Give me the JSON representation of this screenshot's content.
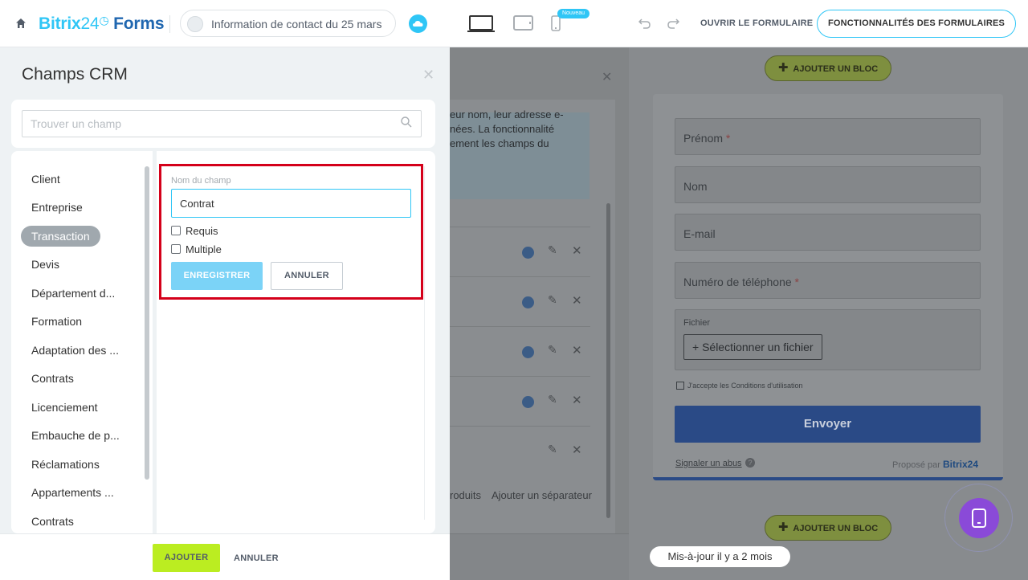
{
  "topbar": {
    "brand_name": "Bitrix",
    "brand_24": "24",
    "brand_suffix": "Forms",
    "form_name": "Information de contact du 25 mars",
    "new_badge": "Nouveau",
    "open_form": "OUVRIR LE FORMULAIRE",
    "features": "FONCTIONNALITÉS DES FORMULAIRES"
  },
  "crm": {
    "title": "Champs CRM",
    "search_placeholder": "Trouver un champ",
    "categories": [
      "Client",
      "Entreprise",
      "Transaction",
      "Devis",
      "Département d...",
      "Formation",
      "Adaptation des ...",
      "Contrats",
      "Licenciement",
      "Embauche de p...",
      "Réclamations",
      "Appartements ...",
      "Contrats"
    ],
    "active_category": "Transaction",
    "edit": {
      "field_label": "Nom du champ",
      "field_value": "Contrat",
      "required_label": "Requis",
      "multiple_label": "Multiple",
      "save": "ENREGISTRER",
      "cancel": "ANNULER"
    },
    "footer": {
      "add": "AJOUTER",
      "cancel": "ANNULER"
    }
  },
  "editor": {
    "hint_text": "eur nom, leur adresse e-\nnées. La fonctionnalité\nement les champs du",
    "footer_products": "roduits",
    "footer_separator": "Ajouter un séparateur",
    "add_block": "AJOUTER UN BLOC",
    "fields": [
      {
        "label": "Prénom",
        "required": "*"
      },
      {
        "label": "Nom",
        "required": ""
      },
      {
        "label": "E-mail",
        "required": ""
      },
      {
        "label": "Numéro de téléphone",
        "required": "*"
      }
    ],
    "file_label": "Fichier",
    "file_button": "+ Sélectionner un fichier",
    "terms": "J'accepte les Conditions d'utilisation",
    "send": "Envoyer",
    "report_abuse": "Signaler un abus",
    "powered_by": "Proposé par",
    "powered_brand": "Bitrix24",
    "updated": "Mis-à-jour il y a 2 mois"
  },
  "colors": {
    "accent": "#2fc6f6",
    "highlight": "#d4001a",
    "add_button": "#bbed21",
    "send_button": "#2a4a86",
    "fab": "#8a4ad8"
  }
}
